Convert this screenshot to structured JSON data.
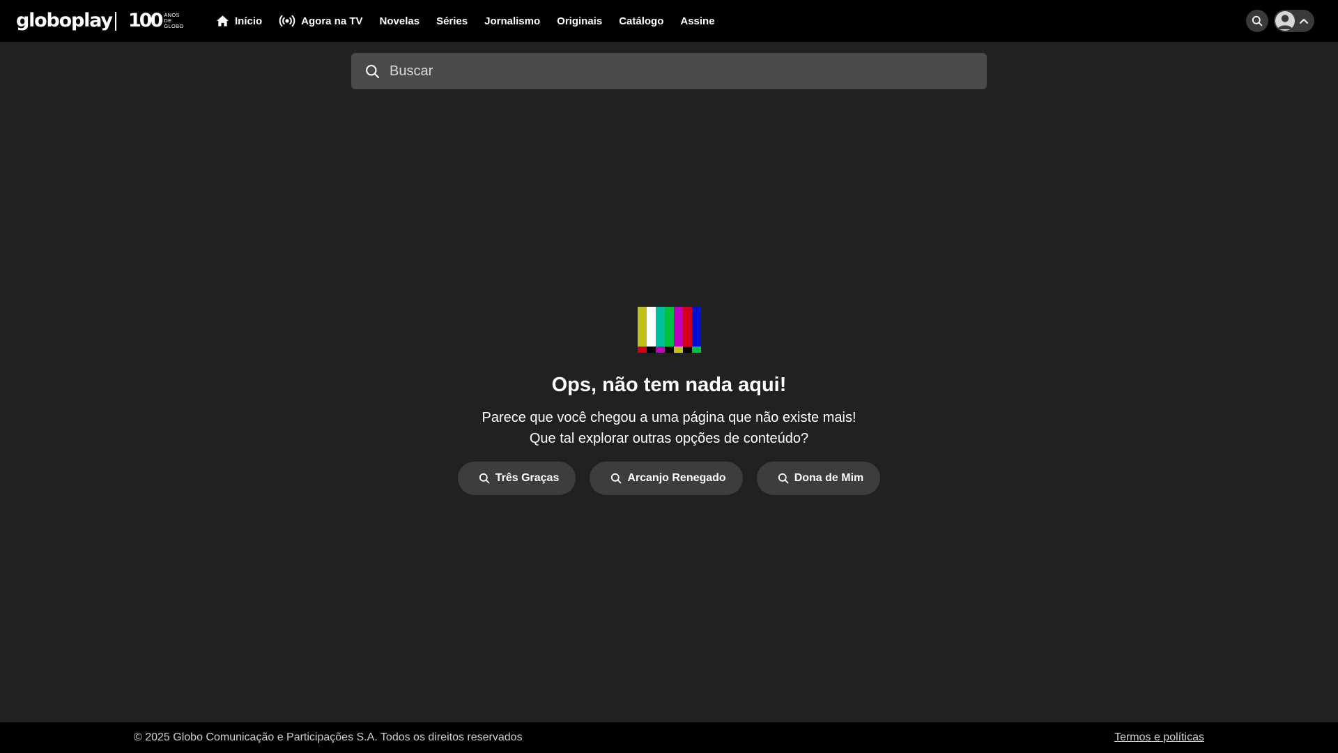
{
  "brand": {
    "logo_text": "globoplay",
    "centenary_number": "100",
    "centenary_line1": "ANOS",
    "centenary_line2": "DE",
    "centenary_line3": "GLOBO"
  },
  "nav": {
    "items": [
      {
        "label": "Início",
        "icon": "home-icon"
      },
      {
        "label": "Agora na TV",
        "icon": "broadcast-icon"
      },
      {
        "label": "Novelas"
      },
      {
        "label": "Séries"
      },
      {
        "label": "Jornalismo"
      },
      {
        "label": "Originais"
      },
      {
        "label": "Catálogo"
      },
      {
        "label": "Assine"
      }
    ]
  },
  "search": {
    "placeholder": "Buscar",
    "value": ""
  },
  "error": {
    "title": "Ops, não tem nada aqui!",
    "line1": "Parece que você chegou a uma página que não existe mais!",
    "line2": "Que tal explorar outras opções de conteúdo?"
  },
  "suggestions": [
    {
      "label": "Três Graças"
    },
    {
      "label": "Arcanjo Renegado"
    },
    {
      "label": "Dona de Mim"
    }
  ],
  "footer": {
    "copyright": "© 2025 Globo Comunicação e Participações S.A. Todos os direitos reservados",
    "terms": "Termos e políticas"
  },
  "colors": {
    "background": "#212121",
    "topbar": "#000000",
    "search_bg": "#4a4a4a",
    "pill_bg": "#3d3d3d"
  }
}
